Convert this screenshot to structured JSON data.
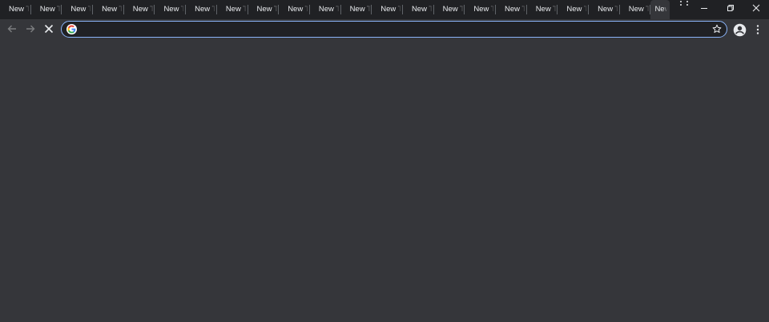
{
  "tabs": [
    {
      "label": "New Tab"
    },
    {
      "label": "New Tab"
    },
    {
      "label": "New Tab"
    },
    {
      "label": "New Tab"
    },
    {
      "label": "New Tab"
    },
    {
      "label": "New Tab"
    },
    {
      "label": "New Tab"
    },
    {
      "label": "New Tab"
    },
    {
      "label": "New Tab"
    },
    {
      "label": "New Tab"
    },
    {
      "label": "New Tab"
    },
    {
      "label": "New Tab"
    },
    {
      "label": "New Tab"
    },
    {
      "label": "New Tab"
    },
    {
      "label": "New Tab"
    },
    {
      "label": "New Tab"
    },
    {
      "label": "New Tab"
    },
    {
      "label": "New Tab"
    },
    {
      "label": "New Tab"
    },
    {
      "label": "New Tab"
    },
    {
      "label": "New Tab"
    }
  ],
  "active_tab": {
    "label": "New Tab"
  },
  "omnibox": {
    "value": "",
    "placeholder": ""
  },
  "colors": {
    "tabstrip_bg": "#202124",
    "toolbar_bg": "#35363a",
    "omnibox_bg": "#202124",
    "focus_ring": "#8ab4f8",
    "text": "#e8eaed"
  },
  "icons": {
    "tab_search": "tab-search-icon",
    "minimize": "minimize-icon",
    "restore": "restore-icon",
    "close": "close-icon",
    "back": "back-arrow-icon",
    "forward": "forward-arrow-icon",
    "stop": "stop-loading-icon",
    "google": "google-icon",
    "bookmark": "star-icon",
    "profile": "profile-icon",
    "menu": "kebab-menu-icon"
  }
}
